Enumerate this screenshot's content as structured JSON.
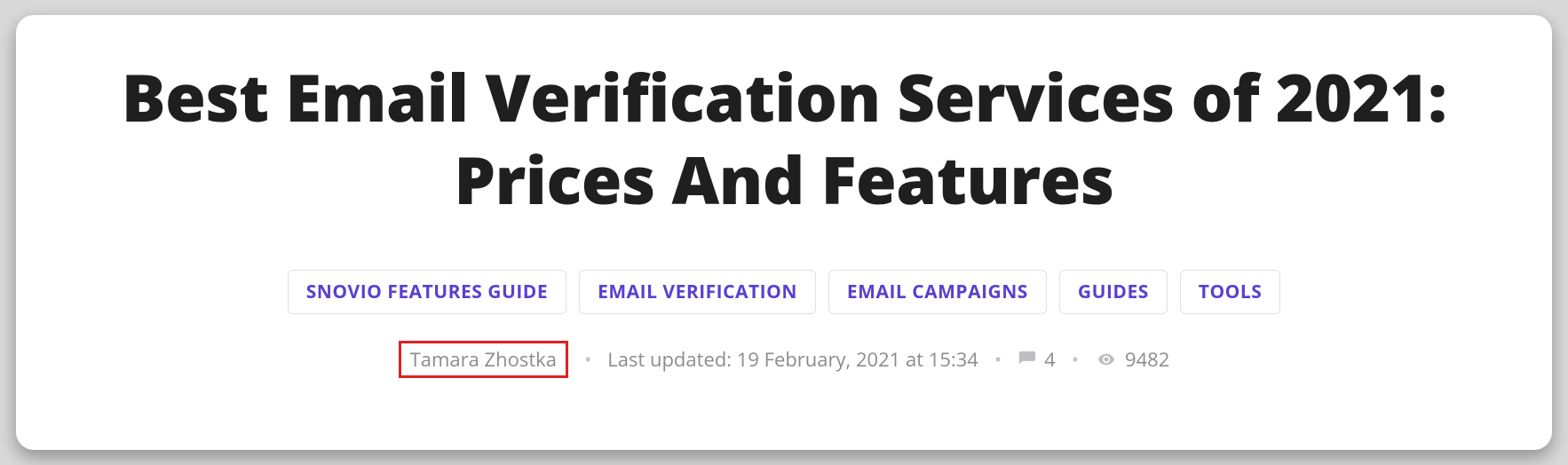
{
  "article": {
    "title": "Best Email Verification Services of 2021: Prices And Features",
    "tags": [
      "SNOVIO FEATURES GUIDE",
      "EMAIL VERIFICATION",
      "EMAIL CAMPAIGNS",
      "GUIDES",
      "TOOLS"
    ],
    "author": "Tamara Zhostka",
    "last_updated_label": "Last updated: 19 February, 2021 at 15:34",
    "comments_count": "4",
    "views_count": "9482"
  },
  "colors": {
    "tag_text": "#5a3fd1",
    "meta_text": "#8b8b93",
    "highlight_border": "#e22020"
  }
}
